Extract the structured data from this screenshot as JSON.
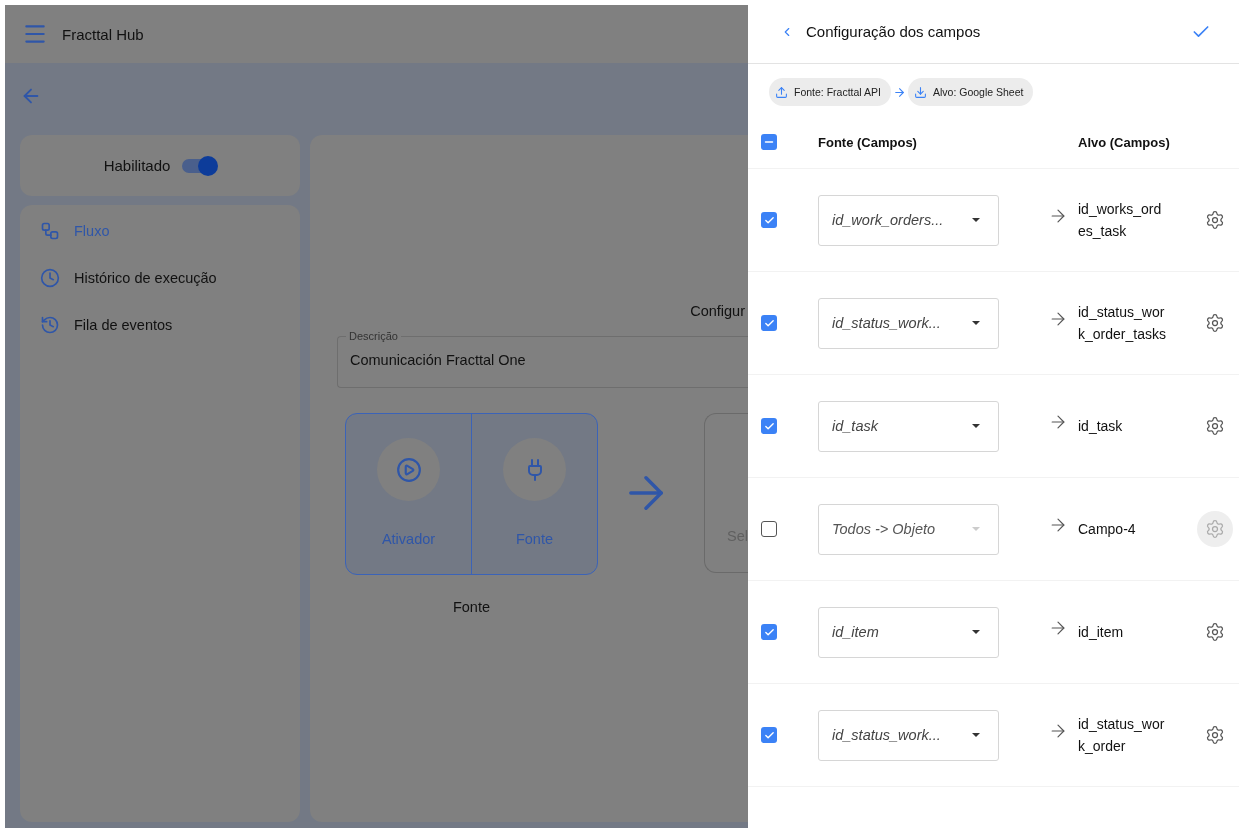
{
  "app_bar": {
    "title": "Fracttal Hub"
  },
  "status_card": {
    "label": "Habilitado",
    "on": true
  },
  "sidebar": {
    "items": [
      {
        "label": "Fluxo",
        "selected": true
      },
      {
        "label": "Histórico de execução",
        "selected": false
      },
      {
        "label": "Fila de eventos",
        "selected": false
      }
    ]
  },
  "main": {
    "heading": "Configur",
    "description": {
      "label": "Descrição",
      "value": "Comunicación Fracttal One"
    },
    "flow_group": {
      "steps": [
        {
          "label": "Ativador"
        },
        {
          "label": "Fonte"
        }
      ],
      "caption": "Fonte"
    },
    "next_step": {
      "label": "Sel"
    }
  },
  "drawer": {
    "title": "Configuração dos campos",
    "chips": [
      {
        "label": "Fonte: Fracttal API",
        "kind": "upload"
      },
      {
        "label": "Alvo: Google Sheet",
        "kind": "download"
      }
    ],
    "select_all": {
      "indeterminate": true
    },
    "columns": [
      "Fonte (Campos)",
      "Alvo (Campos)"
    ],
    "rows": [
      {
        "checked": true,
        "source": "id_work_orders...",
        "target": "id_works_ordes_task",
        "disabled": false,
        "hovered": false
      },
      {
        "checked": true,
        "source": "id_status_work...",
        "target": "id_status_work_order_tasks",
        "disabled": false,
        "hovered": false
      },
      {
        "checked": true,
        "source": "id_task",
        "target": "id_task",
        "disabled": false,
        "hovered": false
      },
      {
        "checked": false,
        "source": "Todos -> Objeto",
        "target": "Campo-4",
        "disabled": true,
        "hovered": true
      },
      {
        "checked": true,
        "source": "id_item",
        "target": "id_item",
        "disabled": false,
        "hovered": false
      },
      {
        "checked": true,
        "source": "id_status_work...",
        "target": "id_status_work_order",
        "disabled": false,
        "hovered": false
      }
    ]
  }
}
